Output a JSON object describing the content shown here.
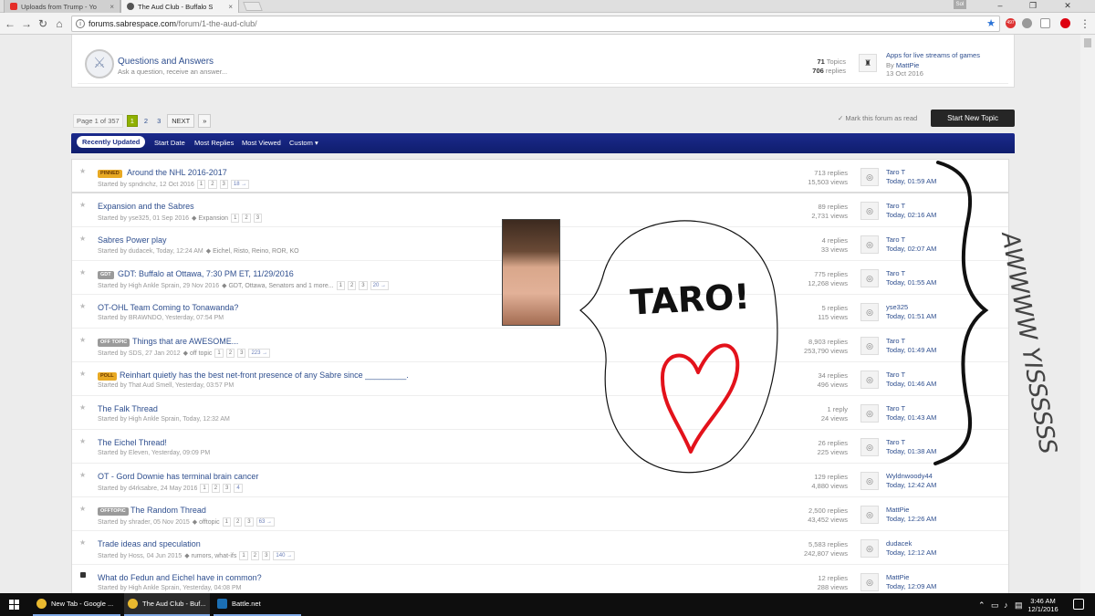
{
  "browser": {
    "tabs": [
      {
        "label": "Uploads from Trump - Yo",
        "favicon_color": "#e52d27"
      },
      {
        "label": "The Aud Club - Buffalo S",
        "favicon_color": "#555555"
      }
    ],
    "profile_label": "Sol",
    "url_domain": "forums.sabrespace.com",
    "url_path": "/forum/1-the-aud-club/",
    "extension_badge": "497"
  },
  "forum_entry": {
    "title": "Questions and Answers",
    "description": "Ask a question, receive an answer...",
    "topics_count": "71",
    "topics_label": "Topics",
    "replies_count": "706",
    "replies_label": "replies",
    "last_post_title": "Apps for live streams of games",
    "last_post_by_prefix": "By",
    "last_post_by": "MattPie",
    "last_post_date": "13 Oct 2016"
  },
  "pagination": {
    "label": "Page 1 of 357",
    "pages": [
      "1",
      "2",
      "3"
    ],
    "next": "NEXT",
    "last": "»"
  },
  "actions": {
    "mark_read": "Mark this forum as read",
    "new_topic": "Start New Topic"
  },
  "sort_tabs": [
    "Recently Updated",
    "Start Date",
    "Most Replies",
    "Most Viewed",
    "Custom"
  ],
  "topics": [
    {
      "badge": "PINNED",
      "title": "Around the NHL 2016-2017",
      "meta": "Started by spndnchz, 12 Oct 2016",
      "tags": "",
      "pages": [
        "1",
        "2",
        "3",
        "18 →"
      ],
      "replies": "713 replies",
      "views": "15,503 views",
      "last_by": "Taro T",
      "last_date": "Today, 01:59 AM"
    },
    {
      "badge": "",
      "title": "Expansion and the Sabres",
      "meta": "Started by yse325, 01 Sep 2016",
      "tags": "Expansion",
      "pages": [
        "1",
        "2",
        "3"
      ],
      "replies": "89 replies",
      "views": "2,731 views",
      "last_by": "Taro T",
      "last_date": "Today, 02:16 AM"
    },
    {
      "badge": "",
      "title": "Sabres Power play",
      "meta": "Started by dudacek, Today, 12:24 AM",
      "tags": "Eichel, Risto, Reino, ROR, KO",
      "pages": [],
      "replies": "4 replies",
      "views": "33 views",
      "last_by": "Taro T",
      "last_date": "Today, 02:07 AM"
    },
    {
      "badge": "GDT",
      "title": "GDT: Buffalo at Ottawa, 7:30 PM ET, 11/29/2016",
      "meta": "Started by High Ankle Sprain, 29 Nov 2016",
      "tags": "GDT, Ottawa, Senators and 1 more...",
      "pages": [
        "1",
        "2",
        "3",
        "20 →"
      ],
      "replies": "775 replies",
      "views": "12,268 views",
      "last_by": "Taro T",
      "last_date": "Today, 01:55 AM"
    },
    {
      "badge": "",
      "title": "OT-OHL Team Coming to Tonawanda?",
      "meta": "Started by BRAWNDO, Yesterday, 07:54 PM",
      "tags": "",
      "pages": [],
      "replies": "5 replies",
      "views": "115 views",
      "last_by": "yse325",
      "last_date": "Today, 01:51 AM"
    },
    {
      "badge": "OFF TOPIC",
      "title": "Things that are AWESOME...",
      "meta": "Started by SDS, 27 Jan 2012",
      "tags": "off topic",
      "pages": [
        "1",
        "2",
        "3",
        "223 →"
      ],
      "replies": "8,903 replies",
      "views": "253,790 views",
      "last_by": "Taro T",
      "last_date": "Today, 01:49 AM"
    },
    {
      "badge": "POLL",
      "title": "Reinhart quietly has the best net-front presence of any Sabre since _________.",
      "meta": "Started by That Aud Smell, Yesterday, 03:57 PM",
      "tags": "",
      "pages": [],
      "replies": "34 replies",
      "views": "496 views",
      "last_by": "Taro T",
      "last_date": "Today, 01:46 AM"
    },
    {
      "badge": "",
      "title": "The Falk Thread",
      "meta": "Started by High Ankle Sprain, Today, 12:32 AM",
      "tags": "",
      "pages": [],
      "replies": "1 reply",
      "views": "24 views",
      "last_by": "Taro T",
      "last_date": "Today, 01:43 AM"
    },
    {
      "badge": "",
      "title": "The Eichel Thread!",
      "meta": "Started by Eleven, Yesterday, 09:09 PM",
      "tags": "",
      "pages": [],
      "replies": "26 replies",
      "views": "225 views",
      "last_by": "Taro T",
      "last_date": "Today, 01:38 AM"
    },
    {
      "badge": "",
      "title": "OT - Gord Downie has terminal brain cancer",
      "meta": "Started by d4rksabre, 24 May 2016",
      "tags": "",
      "pages": [
        "1",
        "2",
        "3",
        "4"
      ],
      "replies": "129 replies",
      "views": "4,880 views",
      "last_by": "Wyldnwoody44",
      "last_date": "Today, 12:42 AM"
    },
    {
      "badge": "OFFTOPIC",
      "title": "The Random Thread",
      "meta": "Started by shrader, 05 Nov 2015",
      "tags": "offtopic",
      "pages": [
        "1",
        "2",
        "3",
        "63 →"
      ],
      "replies": "2,500 replies",
      "views": "43,452 views",
      "last_by": "MattPie",
      "last_date": "Today, 12:26 AM"
    },
    {
      "badge": "",
      "title": "Trade ideas and speculation",
      "meta": "Started by Hoss, 04 Jun 2015",
      "tags": "rumors, what-ifs",
      "pages": [
        "1",
        "2",
        "3",
        "140 →"
      ],
      "replies": "5,583 replies",
      "views": "242,807 views",
      "last_by": "dudacek",
      "last_date": "Today, 12:12 AM"
    },
    {
      "badge": "",
      "title": "What do Fedun and Eichel have in common?",
      "meta": "Started by High Ankle Sprain, Yesterday, 04:08 PM",
      "tags": "",
      "pages": [],
      "replies": "12 replies",
      "views": "288 views",
      "last_by": "MattPie",
      "last_date": "Today, 12:09 AM"
    }
  ],
  "drawing": {
    "speech_text": "TARO!",
    "side_text": "AWWWW YISSSSSS"
  },
  "taskbar": {
    "items": [
      {
        "label": "New Tab - Google ...",
        "color": "#e9b92f"
      },
      {
        "label": "The Aud Club - Buf...",
        "color": "#e9b92f"
      },
      {
        "label": "Battle.net",
        "color": "#1b6fb4"
      }
    ],
    "time": "3:46 AM",
    "date": "12/1/2016"
  },
  "colors": {
    "link": "#2f4f8f",
    "sortbar": "#1b2a8c",
    "active_page": "#8fb100",
    "pinned_badge": "#e8a923",
    "heart": "#e3121b"
  }
}
